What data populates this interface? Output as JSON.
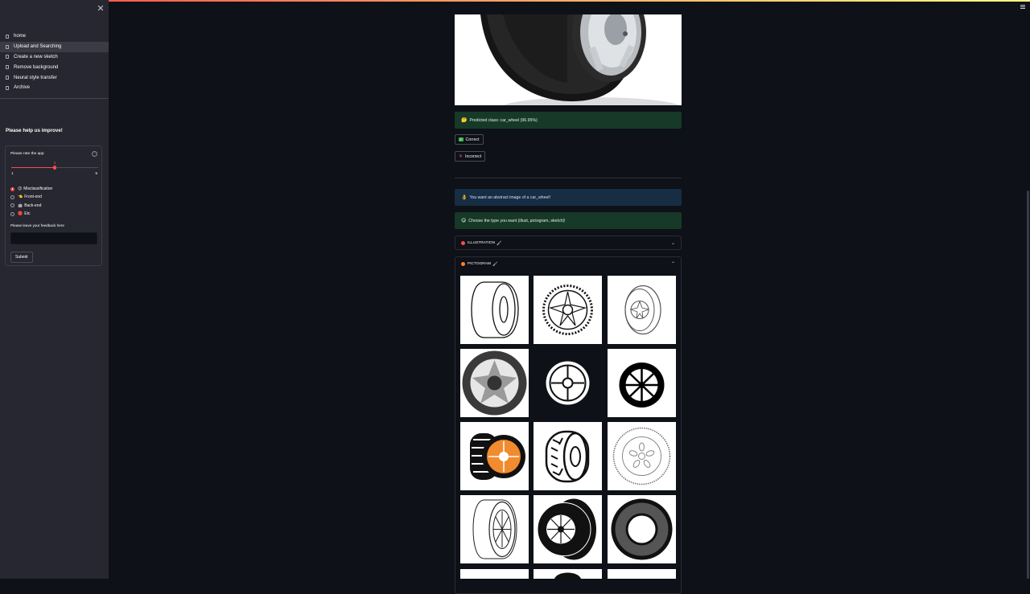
{
  "sidebar": {
    "nav_items": [
      {
        "label": "home",
        "active": false
      },
      {
        "label": "Upload and Searching",
        "active": true
      },
      {
        "label": "Create a new sketch",
        "active": false
      },
      {
        "label": "Remove background",
        "active": false
      },
      {
        "label": "Neural style transfer",
        "active": false
      },
      {
        "label": "Archive",
        "active": false
      }
    ],
    "close_icon": "close-icon",
    "feedback": {
      "heading": "Please help us improve!",
      "rate_label": "Please rate the app",
      "slider": {
        "min_label": "1",
        "max_label": "5",
        "value_label": "3",
        "value": 3,
        "min": 1,
        "max": 5
      },
      "radio_options": [
        {
          "label": "Misclassification",
          "emoji": "😕",
          "selected": true
        },
        {
          "label": "Front-end",
          "emoji": "👈",
          "selected": false
        },
        {
          "label": "Back-end",
          "emoji": "🤖",
          "selected": false
        },
        {
          "label": "Etc",
          "emoji": "🔴",
          "selected": false
        }
      ],
      "textarea_label": "Please leave your feedback here",
      "submit_label": "Submit"
    }
  },
  "main": {
    "predicted": {
      "emoji": "🤔",
      "text": "Predicted class: car_wheel (96.95%)"
    },
    "correct_label": "Correct",
    "incorrect_label": "Incorrect",
    "abstract_info": {
      "emoji": "👌",
      "text": "You want an abstract image of a car_wheel!"
    },
    "choose_type": {
      "emoji": "😋",
      "text": "Choose the type you want (illust, pictogram, sketch)!"
    },
    "expanders": [
      {
        "label": "ILLUSTRATION",
        "emoji": "🖌",
        "expanded": false
      },
      {
        "label": "PICTOGRAM",
        "emoji": "🖌",
        "expanded": true
      }
    ]
  },
  "colors": {
    "accent": "#ff4b4b",
    "success_bg": "#173928",
    "info_bg": "#172d43",
    "background": "#0e1117",
    "sidebar_bg": "#262730"
  }
}
